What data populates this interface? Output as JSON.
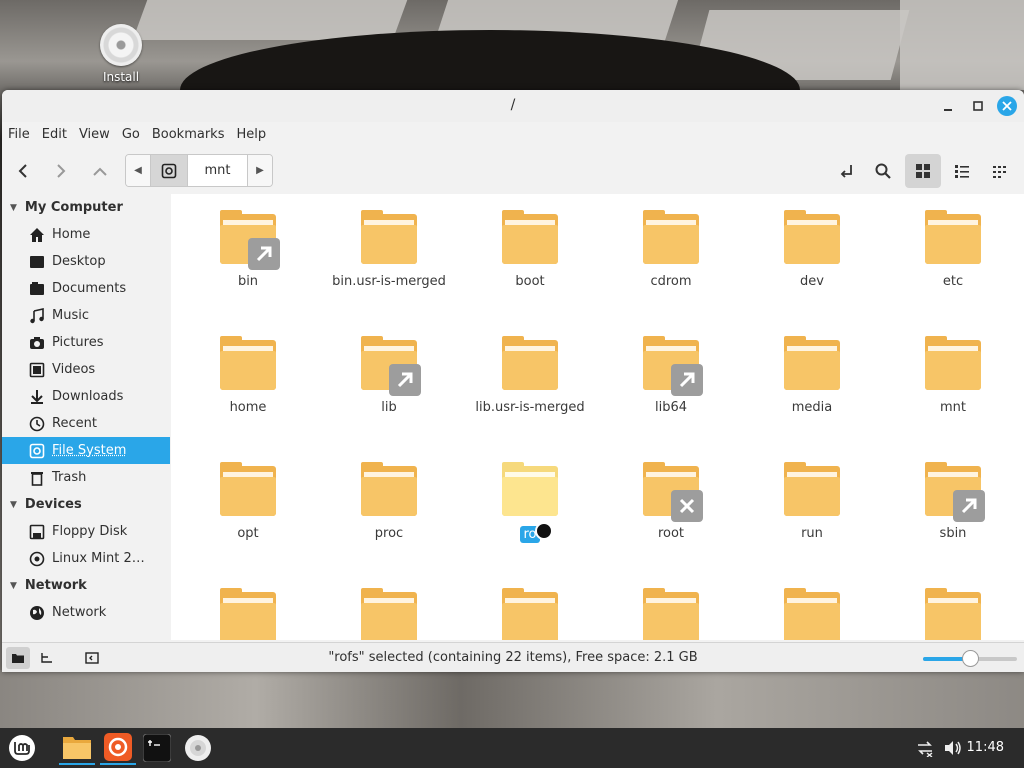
{
  "desktop": {
    "icons": [
      {
        "label": "Install",
        "icon": "disc-icon"
      }
    ]
  },
  "window": {
    "title": "/",
    "controls": {
      "minimize": "minimize-icon",
      "maximize": "maximize-icon",
      "close": "close-icon"
    }
  },
  "menubar": {
    "items": [
      "File",
      "Edit",
      "View",
      "Go",
      "Bookmarks",
      "Help"
    ]
  },
  "toolbar": {
    "back": "chevron-left-icon",
    "forward": "chevron-right-icon",
    "up": "chevron-up-icon",
    "path_segment": "mnt"
  },
  "sidebar": {
    "sections": [
      {
        "title": "My Computer",
        "items": [
          {
            "label": "Home",
            "icon": "home-icon"
          },
          {
            "label": "Desktop",
            "icon": "desktop-icon"
          },
          {
            "label": "Documents",
            "icon": "documents-icon"
          },
          {
            "label": "Music",
            "icon": "music-icon"
          },
          {
            "label": "Pictures",
            "icon": "camera-icon"
          },
          {
            "label": "Videos",
            "icon": "video-icon"
          },
          {
            "label": "Downloads",
            "icon": "download-icon"
          },
          {
            "label": "Recent",
            "icon": "clock-icon"
          },
          {
            "label": "File System",
            "icon": "drive-icon",
            "selected": true
          },
          {
            "label": "Trash",
            "icon": "trash-icon"
          }
        ]
      },
      {
        "title": "Devices",
        "items": [
          {
            "label": "Floppy Disk",
            "icon": "floppy-icon"
          },
          {
            "label": "Linux Mint 2…",
            "icon": "disc-icon"
          }
        ]
      },
      {
        "title": "Network",
        "items": [
          {
            "label": "Network",
            "icon": "globe-icon"
          }
        ]
      }
    ]
  },
  "files": [
    {
      "name": "bin",
      "emblem": "symlink"
    },
    {
      "name": "bin.usr-is-merged"
    },
    {
      "name": "boot"
    },
    {
      "name": "cdrom"
    },
    {
      "name": "dev"
    },
    {
      "name": "etc"
    },
    {
      "name": "home"
    },
    {
      "name": "lib",
      "emblem": "symlink"
    },
    {
      "name": "lib.usr-is-merged"
    },
    {
      "name": "lib64",
      "emblem": "symlink"
    },
    {
      "name": "media"
    },
    {
      "name": "mnt"
    },
    {
      "name": "opt"
    },
    {
      "name": "proc"
    },
    {
      "name": "ro",
      "selected": true
    },
    {
      "name": "root",
      "emblem": "unreadable"
    },
    {
      "name": "run"
    },
    {
      "name": "sbin",
      "emblem": "symlink"
    },
    {
      "name": ""
    },
    {
      "name": ""
    },
    {
      "name": ""
    },
    {
      "name": ""
    },
    {
      "name": ""
    },
    {
      "name": ""
    }
  ],
  "statusbar": {
    "text": "\"rofs\" selected (containing 22 items), Free space: 2.1 GB",
    "zoom_level": 0.5
  },
  "taskbar": {
    "apps": [
      {
        "name": "menu",
        "icon": "mint-menu-icon"
      },
      {
        "name": "files",
        "icon": "folder-icon",
        "running": true
      },
      {
        "name": "firefox",
        "icon": "firefox-icon",
        "running": true
      },
      {
        "name": "terminal",
        "icon": "terminal-icon"
      },
      {
        "name": "install",
        "icon": "disc-icon"
      }
    ],
    "clock": "11:48"
  },
  "colors": {
    "accent": "#2aa6e8",
    "folder": "#f7c567",
    "taskbar": "#2b2b2b"
  }
}
